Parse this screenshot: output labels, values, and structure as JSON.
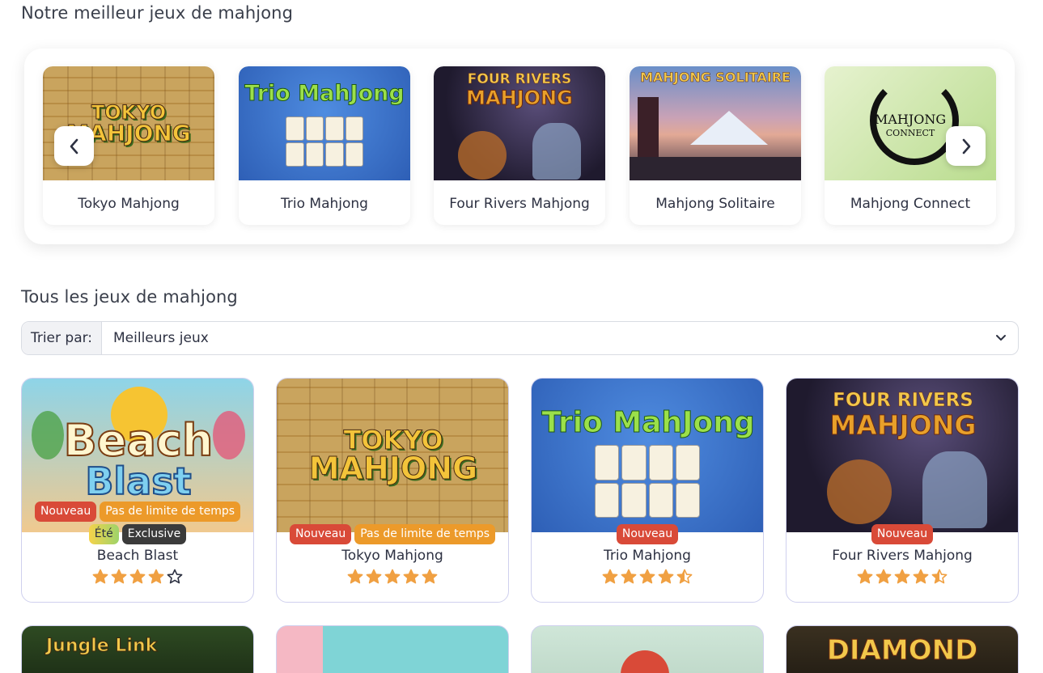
{
  "sections": {
    "best_title": "Notre meilleur jeux de mahjong",
    "all_title": "Tous les jeux de mahjong"
  },
  "carousel": {
    "items": [
      {
        "title": "Tokyo Mahjong",
        "art": "TOKYO MAHJONG",
        "art_top": "TOKYO",
        "art_bottom": "MAHJONG"
      },
      {
        "title": "Trio Mahjong",
        "art": "Trio MahJong"
      },
      {
        "title": "Four Rivers Mahjong",
        "art_top": "FOUR RIVERS",
        "art_bottom": "MAHJONG"
      },
      {
        "title": "Mahjong Solitaire",
        "art": "MAHJONG SOLITAIRE"
      },
      {
        "title": "Mahjong Connect",
        "art_top": "MAHJONG",
        "art_bottom": "CONNECT"
      }
    ],
    "prev_icon": "chevron-left-icon",
    "next_icon": "chevron-right-icon"
  },
  "sort": {
    "label": "Trier par:",
    "selected": "Meilleurs jeux",
    "icon": "chevron-down-icon"
  },
  "games": [
    {
      "title": "Beach Blast",
      "art_top": "Beach",
      "art_bottom": "Blast",
      "badges_row1": [
        "Nouveau",
        "Pas de limite de temps"
      ],
      "badges_row2": [
        "Été",
        "Exclusive"
      ],
      "rating": 4
    },
    {
      "title": "Tokyo Mahjong",
      "art_top": "TOKYO",
      "art_bottom": "MAHJONG",
      "badges_row1": [
        "Nouveau",
        "Pas de limite de temps"
      ],
      "rating": 5
    },
    {
      "title": "Trio Mahjong",
      "art": "Trio MahJong",
      "badges_row1": [
        "Nouveau"
      ],
      "rating": 4.5
    },
    {
      "title": "Four Rivers Mahjong",
      "art_top": "FOUR RIVERS",
      "art_bottom": "MAHJONG",
      "badges_row1": [
        "Nouveau"
      ],
      "rating": 4.5
    }
  ],
  "more_games": [
    {
      "art": "Jungle Link"
    },
    {
      "art": ""
    },
    {
      "art": ""
    },
    {
      "art": "DIAMOND"
    }
  ],
  "colors": {
    "badge_new": "#d94a38",
    "badge_time": "#ec9a2a",
    "badge_exclusive": "#3b3b3b",
    "star": "#f0a042",
    "card_border": "#cfd0ee"
  }
}
